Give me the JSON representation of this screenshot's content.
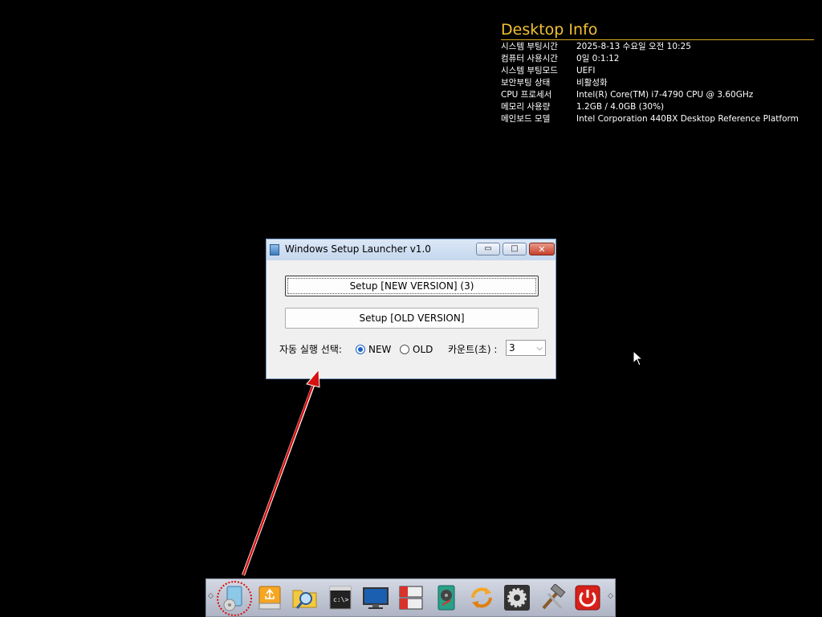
{
  "desktop_info": {
    "title": "Desktop Info",
    "rows": [
      {
        "key": "시스템 부팅시간",
        "value": "2025-8-13 수요일 오전 10:25"
      },
      {
        "key": "컴퓨터 사용시간",
        "value": "0일 0:1:12"
      },
      {
        "key": "시스템 부팅모드",
        "value": "UEFI"
      },
      {
        "key": "보안부팅 상태",
        "value": "비활성화"
      },
      {
        "key": "CPU 프로세서",
        "value": "Intel(R) Core(TM) i7-4790 CPU @ 3.60GHz"
      },
      {
        "key": "메모리 사용량",
        "value": "1.2GB / 4.0GB (30%)"
      },
      {
        "key": "메인보드 모델",
        "value": "Intel Corporation 440BX Desktop Reference Platform"
      }
    ]
  },
  "window": {
    "title": "Windows Setup Launcher v1.0",
    "minimize_glyph": "▭",
    "maximize_glyph": "□",
    "close_glyph": "✕",
    "setup_new_label": "Setup [NEW VERSION] (3)",
    "setup_old_label": "Setup [OLD VERSION]",
    "auto_run_label": "자동 실행 선택:",
    "radio_new_label": "NEW",
    "radio_old_label": "OLD",
    "selected_option": "NEW",
    "count_label": "카운트(초) :",
    "count_value": "3",
    "count_arrow": "⌵"
  },
  "dock": {
    "left_arrow": "◇",
    "right_arrow": "◇",
    "icons": [
      "setup-launcher-icon",
      "usb-drive-icon",
      "folder-search-icon",
      "command-prompt-icon",
      "monitor-icon",
      "partition-tool-icon",
      "disk-tool-icon",
      "sync-icon",
      "settings-gear-icon",
      "tools-hammer-icon",
      "power-icon"
    ]
  },
  "colors": {
    "info_title": "#f2c230",
    "annotation_red": "#d81010",
    "close_button": "#c6402a",
    "radio_selected": "#1b62c8"
  }
}
